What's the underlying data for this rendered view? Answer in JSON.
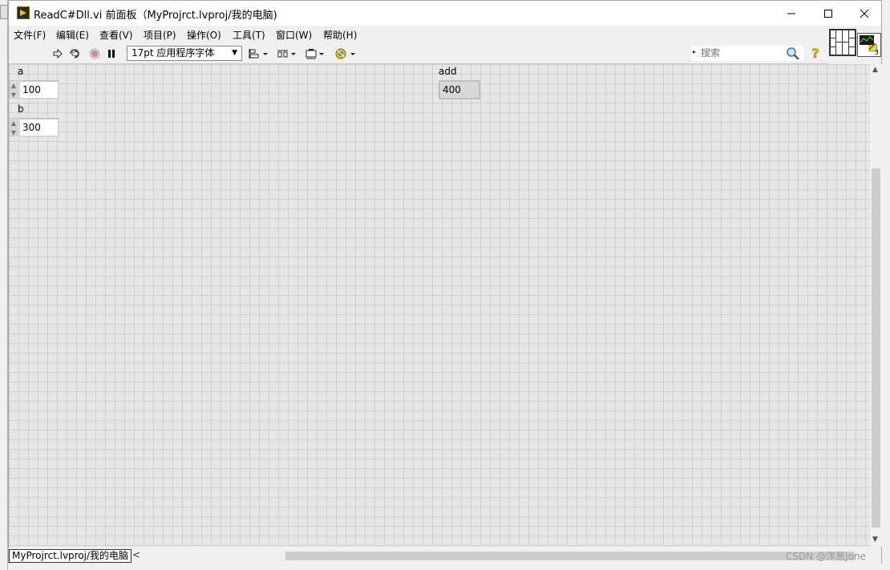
{
  "window": {
    "title": "ReadC#Dll.vi 前面板（MyProjrct.lvproj/我的电脑)"
  },
  "menu": [
    "文件(F)",
    "编辑(E)",
    "查看(V)",
    "项目(P)",
    "操作(O)",
    "工具(T)",
    "窗口(W)",
    "帮助(H)"
  ],
  "toolbar": {
    "font_select": "17pt 应用程序字体",
    "search_placeholder": "搜索"
  },
  "connector_pane_number": "3",
  "controls": {
    "a": {
      "label": "a",
      "value": "100"
    },
    "b": {
      "label": "b",
      "value": "300"
    },
    "add": {
      "label": "add",
      "value": "400"
    }
  },
  "status": {
    "path": "MyProjrct.lvproj/我的电脑"
  },
  "watermark": "CSDN @洋葱Jone",
  "icons": [
    "run-arrow-icon",
    "run-continuously-icon",
    "abort-icon",
    "pause-icon",
    "align-objects-icon",
    "distribute-objects-icon",
    "resize-objects-icon",
    "reorder-icon",
    "search-icon",
    "context-help-icon"
  ]
}
